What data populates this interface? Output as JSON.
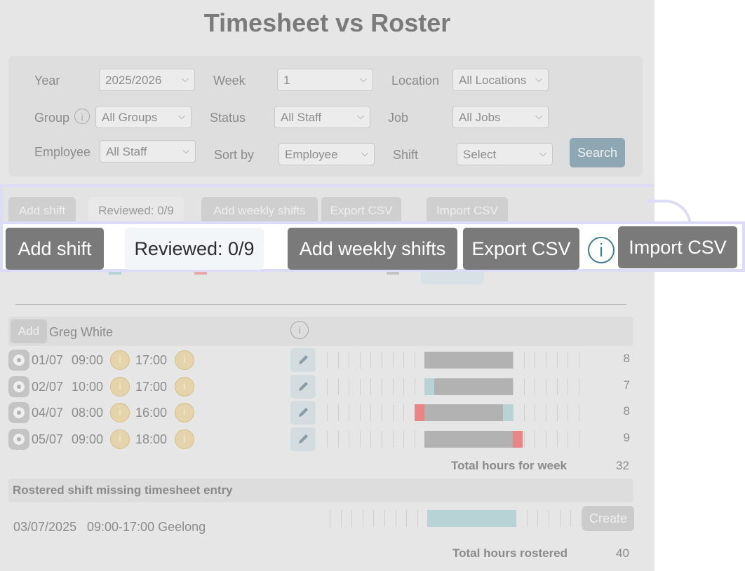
{
  "page": {
    "title": "Timesheet vs Roster"
  },
  "filters": {
    "year_label": "Year",
    "year_value": "2025/2026",
    "week_label": "Week",
    "week_value": "1",
    "location_label": "Location",
    "location_value": "All Locations",
    "group_label": "Group",
    "group_value": "All Groups",
    "status_label": "Status",
    "status_value": "All Staff",
    "job_label": "Job",
    "job_value": "All Jobs",
    "employee_label": "Employee",
    "employee_value": "All Staff",
    "sortby_label": "Sort by",
    "sortby_value": "Employee",
    "shift_label": "Shift",
    "shift_value": "Select",
    "search_label": "Search",
    "info_glyph": "i"
  },
  "toolbar": {
    "add_shift": "Add shift",
    "reviewed": "Reviewed: 0/9",
    "add_weekly": "Add weekly shifts",
    "export_csv": "Export CSV",
    "import_csv": "Import CSV",
    "info_glyph": "i"
  },
  "employee": {
    "add_label": "Add",
    "name": "Greg White",
    "info_glyph": "i",
    "shifts": [
      {
        "date": "01/07",
        "start": "09:00",
        "end": "17:00",
        "hours": "8",
        "segments": [
          [
            "worked",
            0,
            9
          ]
        ]
      },
      {
        "date": "02/07",
        "start": "10:00",
        "end": "17:00",
        "hours": "7",
        "segments": [
          [
            "rostered",
            0,
            1
          ],
          [
            "worked",
            1,
            9
          ]
        ]
      },
      {
        "date": "04/07",
        "start": "08:00",
        "end": "16:00",
        "hours": "8",
        "segments": [
          [
            "early",
            -1,
            0
          ],
          [
            "worked",
            0,
            8
          ],
          [
            "rostered",
            8,
            9
          ]
        ]
      },
      {
        "date": "05/07",
        "start": "09:00",
        "end": "18:00",
        "hours": "9",
        "segments": [
          [
            "worked",
            0,
            9
          ],
          [
            "late",
            9,
            10
          ]
        ]
      }
    ],
    "total_label": "Total hours for week",
    "total_value": "32"
  },
  "missing": {
    "header": "Rostered shift missing timesheet entry",
    "date": "03/07/2025",
    "time_location": "09:00-17:00 Geelong",
    "create_label": "Create",
    "total_label": "Total hours rostered",
    "total_value": "40"
  },
  "colors": {
    "worked": "#b2b2b2",
    "rostered": "#b8d3d6",
    "early": "#e88686",
    "late": "#e88686",
    "accent": "#3f7d8d",
    "search_button": "#8fa7b3"
  }
}
